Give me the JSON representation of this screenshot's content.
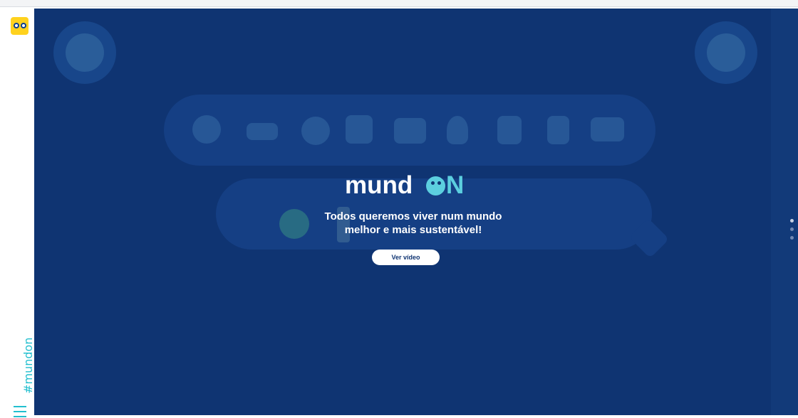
{
  "sidebar": {
    "logo_icon": "mundon-owl-logo-icon",
    "hashtag": "#mundon",
    "menu_icon": "hamburger-menu-icon"
  },
  "hero": {
    "brand_prefix": "mund",
    "brand_suffix": "N",
    "brand_accent": "#5ccfdf",
    "headline_line1": "Todos queremos viver num mundo",
    "headline_line2": "melhor e mais sustentável!",
    "video_button_label": "Ver vídeo"
  },
  "background_icons": [
    "people-icon",
    "car-icon",
    "plate-icon",
    "bus-icon",
    "fire-truck-icon",
    "lightbulb-icon",
    "faucet-icon",
    "trash-bin-icon",
    "fridge-icon",
    "globe-icon",
    "plug-icon"
  ],
  "avatars": [
    "boy-avatar",
    "girl-avatar"
  ],
  "pagination": {
    "count": 3,
    "active_index": 0
  },
  "colors": {
    "background": "#0f3472",
    "accent": "#22bfcf",
    "logo_yellow": "#ffd21e"
  }
}
